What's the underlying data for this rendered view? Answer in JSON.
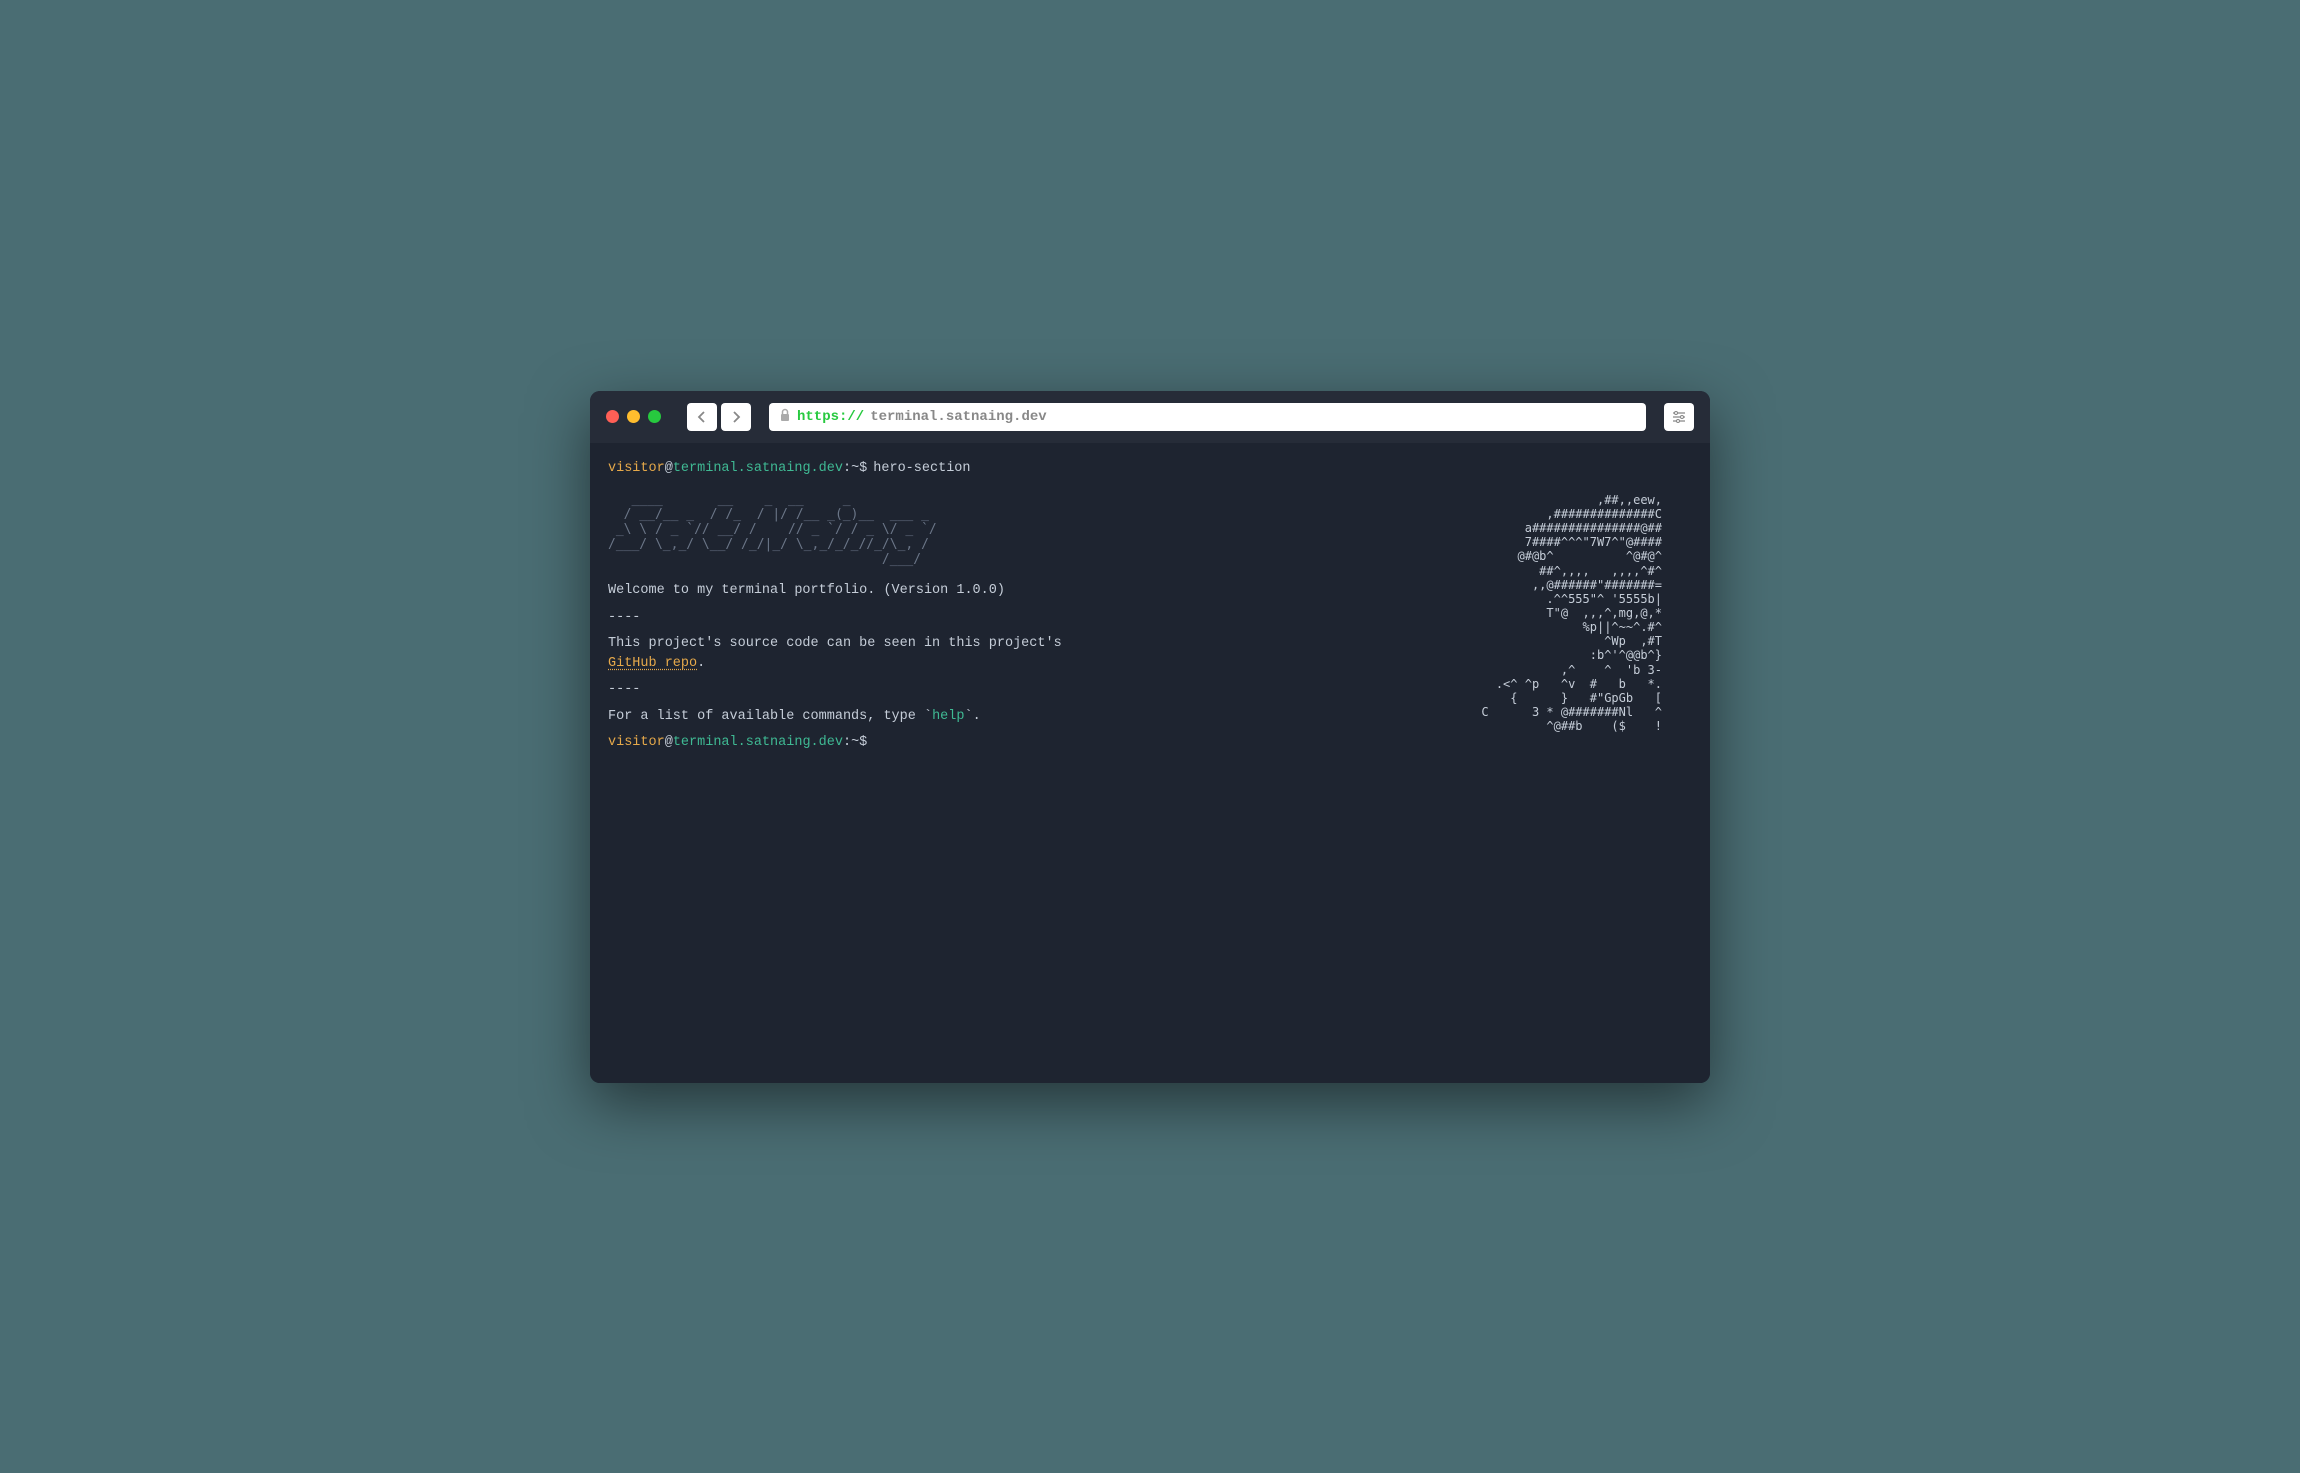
{
  "titlebar": {
    "url_scheme": "https://",
    "url_host": "terminal.satnaing.dev"
  },
  "prompt": {
    "user": "visitor",
    "at": "@",
    "host": "terminal.satnaing.dev",
    "path_sep": ":~$",
    "command": "hero-section"
  },
  "ascii_title": "   ____       __    _  __     _         \n  / __/__ _  / /_  / |/ /__ _(_)__  ___ _\n _\\ \\ / _ `// __/ /    // _ `/ / _ \\/ _ `/\n/___/ \\_,_/ \\__/ /_/|_/ \\_,_/_/_//_/\\_, / \n                                   /___/  ",
  "welcome": "Welcome to my terminal portfolio. (Version 1.0.0)",
  "divider": "----",
  "source_prefix": "This project's source code can be seen in this project's ",
  "repo_link": "GitHub repo",
  "source_suffix": ".",
  "help_prefix": "For a list of available commands, type `",
  "help_cmd": "help",
  "help_suffix": "`.",
  "ascii_art": "           ,##,,eew,\n         ,##############C\n        a###############@##\n       7####^^^\"7W7^\"@####\n       @#@b^          ^@#@^\n        ##^,,,,   ,,,,^#^\n       ,,@######\"#######=\n        .^^555\"^ '5555b|\n        T\"@  ,,,^,mg,@,*\n           %p||^~~^.#^\n            ^Wp  ,#T\n           :b^'^@@b^}\n        ,^    ^  'b 3-\n    .<^ ^p   ^v  #   b   *.\n  {      }   #\"GpGb   [\n  C      3 * @#######Nl   ^\n             ^@##b    ($    !"
}
